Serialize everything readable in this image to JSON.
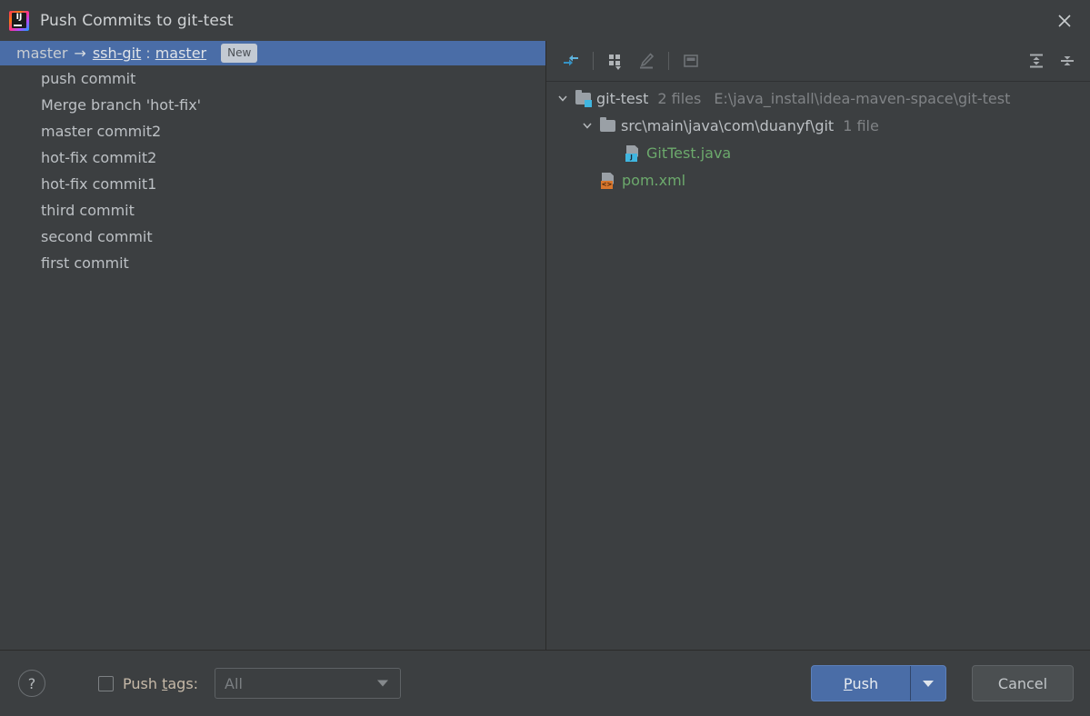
{
  "window": {
    "title": "Push Commits to git-test",
    "logo_icon": "intellij-idea-logo",
    "close_icon": "close-icon"
  },
  "commits_panel": {
    "branch_row": {
      "source_branch": "master",
      "arrow": "→",
      "remote": "ssh-git",
      "separator": ":",
      "target_branch": "master",
      "badge": "New"
    },
    "commits": [
      {
        "message": "push commit"
      },
      {
        "message": "Merge branch 'hot-fix'"
      },
      {
        "message": "master commit2"
      },
      {
        "message": "hot-fix commit2"
      },
      {
        "message": "hot-fix commit1"
      },
      {
        "message": "third commit"
      },
      {
        "message": "second commit"
      },
      {
        "message": "first commit"
      }
    ]
  },
  "files_panel": {
    "toolbar": {
      "left_items": [
        {
          "icon": "show-diff-icon",
          "enabled": true
        },
        {
          "icon": "group-by-icon",
          "enabled": true
        },
        {
          "icon": "edit-source-icon",
          "enabled": false
        },
        {
          "icon": "preview-window-icon",
          "enabled": false
        }
      ],
      "right_items": [
        {
          "icon": "expand-all-icon",
          "enabled": true
        },
        {
          "icon": "collapse-all-icon",
          "enabled": true
        }
      ]
    },
    "tree": [
      {
        "name": "git-test",
        "count": "2 files",
        "path": "E:\\java_install\\idea-maven-space\\git-test",
        "icon": "module-folder-icon",
        "expanded": true
      },
      {
        "name": "src\\main\\java\\com\\duanyf\\git",
        "count": "1 file",
        "path": "",
        "icon": "folder-icon",
        "expanded": true
      },
      {
        "name": "GitTest.java",
        "count": "",
        "path": "",
        "icon": "java-file-icon",
        "badge_text": "J"
      },
      {
        "name": "pom.xml",
        "count": "",
        "path": "",
        "icon": "xml-file-icon",
        "badge_text": "<>"
      }
    ]
  },
  "footer": {
    "help_label": "?",
    "push_tags_label_before": "Push ",
    "push_tags_mnemonic": "t",
    "push_tags_label_after": "ags:",
    "push_tags_checked": false,
    "tags_select_value": "All",
    "push_button_mnemonic": "P",
    "push_button_label_rest": "ush",
    "cancel_button_label": "Cancel"
  },
  "colors": {
    "background": "#3c3f41",
    "selection": "#4a6da7",
    "accent_blue": "#3592c4",
    "file_green": "#6ca96c",
    "muted_text": "#808386",
    "primary_text": "#bcc0c4"
  }
}
